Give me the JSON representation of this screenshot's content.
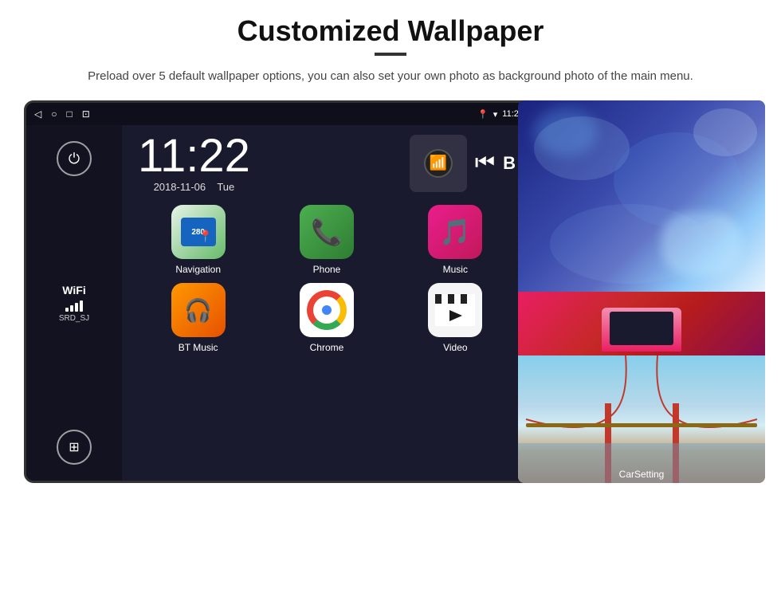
{
  "header": {
    "title": "Customized Wallpaper",
    "description": "Preload over 5 default wallpaper options, you can also set your own photo as background photo of the main menu."
  },
  "device": {
    "status_bar": {
      "back_icon": "◁",
      "home_icon": "○",
      "recent_icon": "□",
      "screenshot_icon": "⊡",
      "location_icon": "📍",
      "wifi_icon": "▾",
      "time": "11:22"
    },
    "clock": {
      "time": "11:22",
      "date": "2018-11-06",
      "day": "Tue"
    },
    "wifi": {
      "label": "WiFi",
      "ssid": "SRD_SJ"
    },
    "apps": [
      {
        "id": "navigation",
        "label": "Navigation",
        "number": "280"
      },
      {
        "id": "phone",
        "label": "Phone"
      },
      {
        "id": "music",
        "label": "Music"
      },
      {
        "id": "btmusic",
        "label": "BT Music"
      },
      {
        "id": "chrome",
        "label": "Chrome"
      },
      {
        "id": "video",
        "label": "Video"
      }
    ],
    "wallpapers": [
      {
        "id": "ice-cave",
        "label": ""
      },
      {
        "id": "pink-device",
        "label": ""
      },
      {
        "id": "bridge",
        "label": "CarSetting"
      }
    ]
  }
}
